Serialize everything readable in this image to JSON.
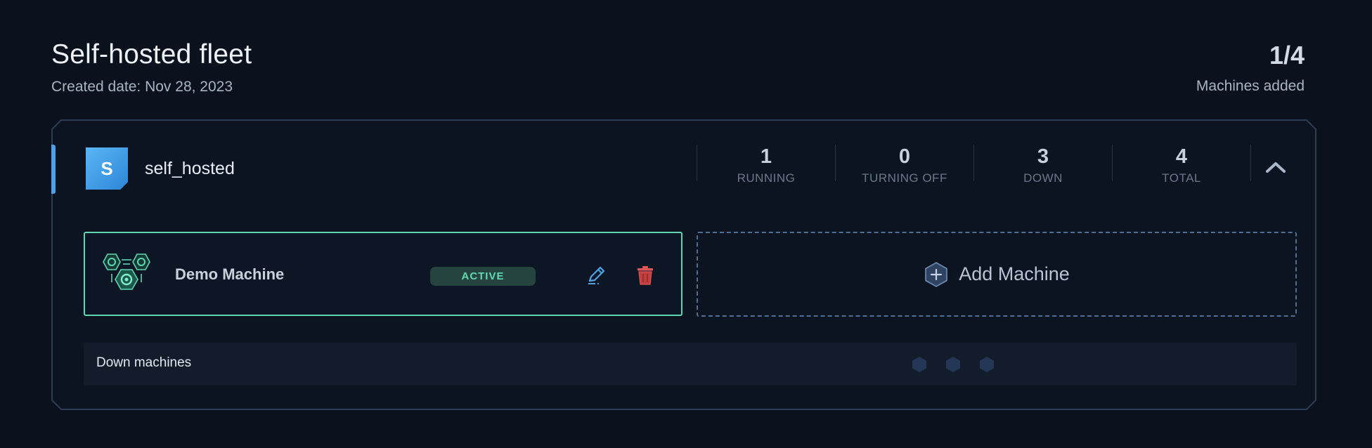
{
  "header": {
    "title": "Self-hosted fleet",
    "created_date": "Created date: Nov 28, 2023",
    "machines_count": "1/4",
    "machines_label": "Machines added"
  },
  "group": {
    "avatar_letter": "S",
    "name": "self_hosted",
    "stats": [
      {
        "value": "1",
        "label": "RUNNING"
      },
      {
        "value": "0",
        "label": "TURNING OFF"
      },
      {
        "value": "3",
        "label": "DOWN"
      },
      {
        "value": "4",
        "label": "TOTAL"
      }
    ],
    "collapse_icon": "chevron-up-icon"
  },
  "machine": {
    "name": "Demo Machine",
    "status": "ACTIVE",
    "icons": {
      "machine": "gears-hexagon-icon",
      "edit": "pencil-icon",
      "delete": "trash-icon"
    }
  },
  "add_machine": {
    "label": "Add Machine",
    "icon": "plus-hexagon-icon"
  },
  "down_machines": {
    "label": "Down machines",
    "count": 3,
    "icon": "hexagon-icon"
  },
  "colors": {
    "background": "#0b111d",
    "accent_green": "#5fd6b2",
    "accent_blue": "#4ea3e6",
    "danger": "#e05555",
    "dashed_border": "#4f6f95"
  }
}
